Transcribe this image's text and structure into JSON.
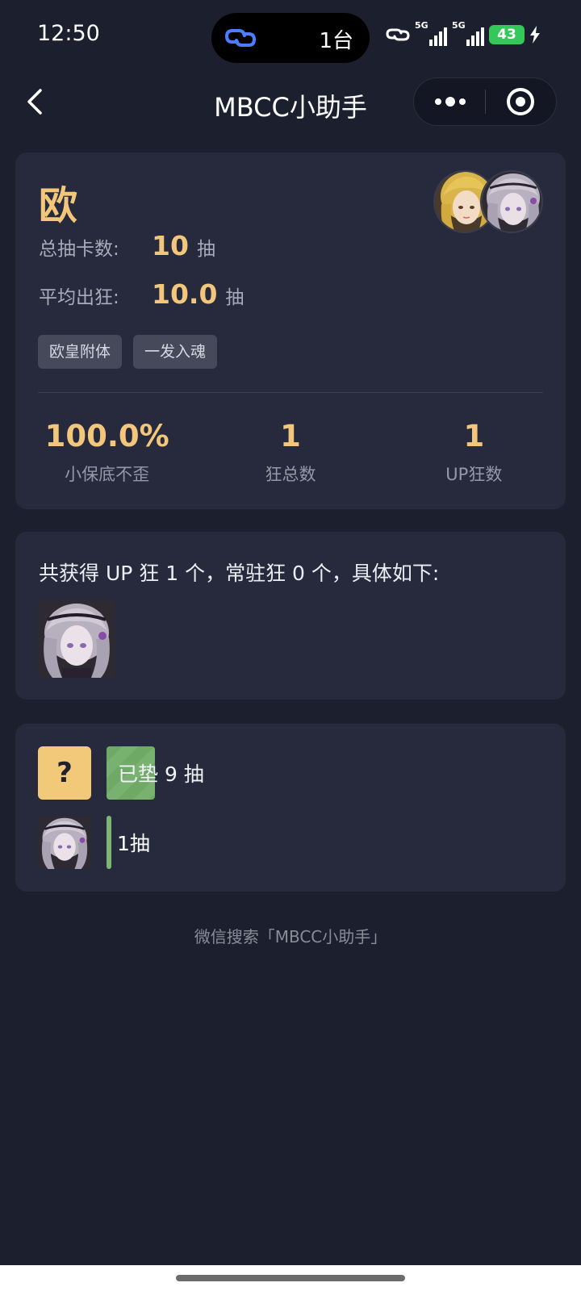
{
  "status_bar": {
    "time": "12:50",
    "island_text": "1台",
    "net1_label": "5G",
    "net2_label": "5G",
    "battery": "43",
    "battery_color": "#34c759"
  },
  "nav": {
    "title": "MBCC小助手",
    "back_icon": "chevron-left-icon",
    "more_icon": "more-dots-icon",
    "close_icon": "target-circle-icon"
  },
  "summary_card": {
    "rank": "欧",
    "total_pulls_label": "总抽卡数:",
    "total_pulls_value": "10",
    "total_pulls_unit": "抽",
    "avg_label": "平均出狂:",
    "avg_value": "10.0",
    "avg_unit": "抽",
    "tags": [
      "欧皇附体",
      "一发入魂"
    ],
    "metrics": [
      {
        "value": "100.0%",
        "label": "小保底不歪"
      },
      {
        "value": "1",
        "label": "狂总数"
      },
      {
        "value": "1",
        "label": "UP狂数"
      }
    ]
  },
  "obtained_card": {
    "summary": "共获得 UP 狂 1 个，常驻狂 0 个，具体如下:"
  },
  "history_card": {
    "pending": {
      "icon_text": "?",
      "text": "已垫 9 抽",
      "fill_fraction": 0.09
    },
    "entries": [
      {
        "text": "1抽",
        "fill_fraction": 0.01
      }
    ]
  },
  "footer": "微信搜索「MBCC小助手」",
  "colors": {
    "background": "#1c1f2e",
    "card": "#272a3d",
    "accent_gold": "#f2c77b",
    "bar_green": "#79b270"
  }
}
